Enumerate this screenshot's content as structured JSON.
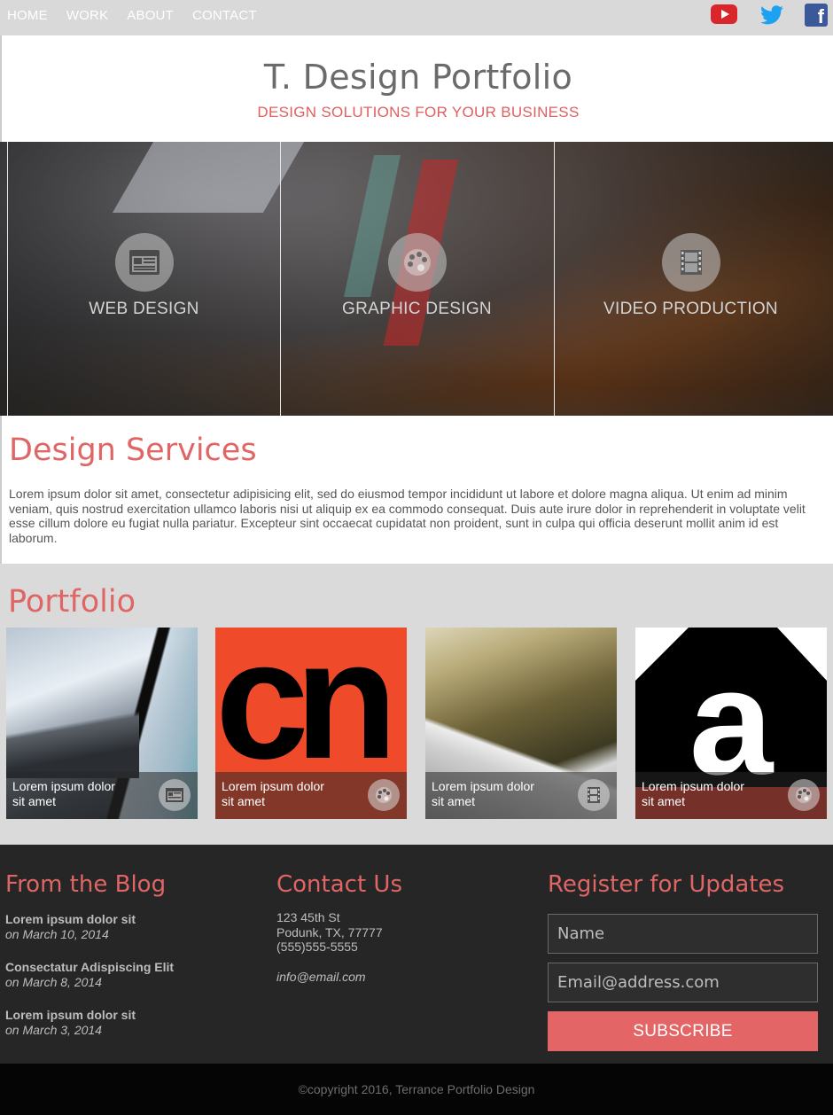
{
  "nav": {
    "links": [
      "HOME",
      "WORK",
      "ABOUT",
      "CONTACT"
    ],
    "social": [
      "youtube-icon",
      "twitter-icon",
      "facebook-icon"
    ]
  },
  "header": {
    "title": "T. Design Portfolio",
    "tagline": "DESIGN SOLUTIONS FOR YOUR BUSINESS"
  },
  "hero": {
    "panels": [
      {
        "label": "WEB DESIGN",
        "icon": "browser-window-icon"
      },
      {
        "label": "GRAPHIC DESIGN",
        "icon": "palette-icon"
      },
      {
        "label": "VIDEO PRODUCTION",
        "icon": "film-icon"
      }
    ]
  },
  "services": {
    "heading": "Design Services",
    "body": "Lorem ipsum dolor sit amet, consectetur adipisicing elit, sed do eiusmod tempor incididunt ut labore et dolore magna aliqua. Ut enim ad minim veniam, quis nostrud exercitation ullamco laboris nisi ut aliquip ex ea commodo consequat. Duis aute irure dolor in reprehenderit in voluptate velit esse cillum dolore eu fugiat nulla pariatur. Excepteur sint occaecat cupidatat non proident, sunt in culpa qui officia deserunt mollit anim id est laborum."
  },
  "portfolio": {
    "heading": "Portfolio",
    "items": [
      {
        "caption": "Lorem ipsum dolor sit amet",
        "icon": "browser-window-icon"
      },
      {
        "caption": "Lorem ipsum dolor sit amet",
        "icon": "palette-icon"
      },
      {
        "caption": "Lorem ipsum dolor sit amet",
        "icon": "film-icon"
      },
      {
        "caption": "Lorem ipsum dolor sit amet",
        "icon": "palette-icon"
      }
    ]
  },
  "blog": {
    "heading": "From the Blog",
    "posts": [
      {
        "title": "Lorem ipsum dolor sit",
        "date": "on March 10, 2014"
      },
      {
        "title": "Consectatur Adispiscing Elit",
        "date": "on March 8, 2014"
      },
      {
        "title": "Lorem ipsum dolor sit",
        "date": "on March 3, 2014"
      }
    ]
  },
  "contact": {
    "heading": "Contact Us",
    "street": "123 45th St",
    "city": "Podunk, TX, 77777",
    "phone": "(555)555-5555",
    "email": "info@email.com"
  },
  "register": {
    "heading": "Register for Updates",
    "name_placeholder": "Name",
    "email_placeholder": "Email@address.com",
    "button": "SUBSCRIBE"
  },
  "copyright": "©copyright 2016, Terrance Portfolio Design",
  "colors": {
    "accent": "#e36565",
    "nav_bg": "#d9d9d9",
    "footer_bg": "#262626"
  }
}
